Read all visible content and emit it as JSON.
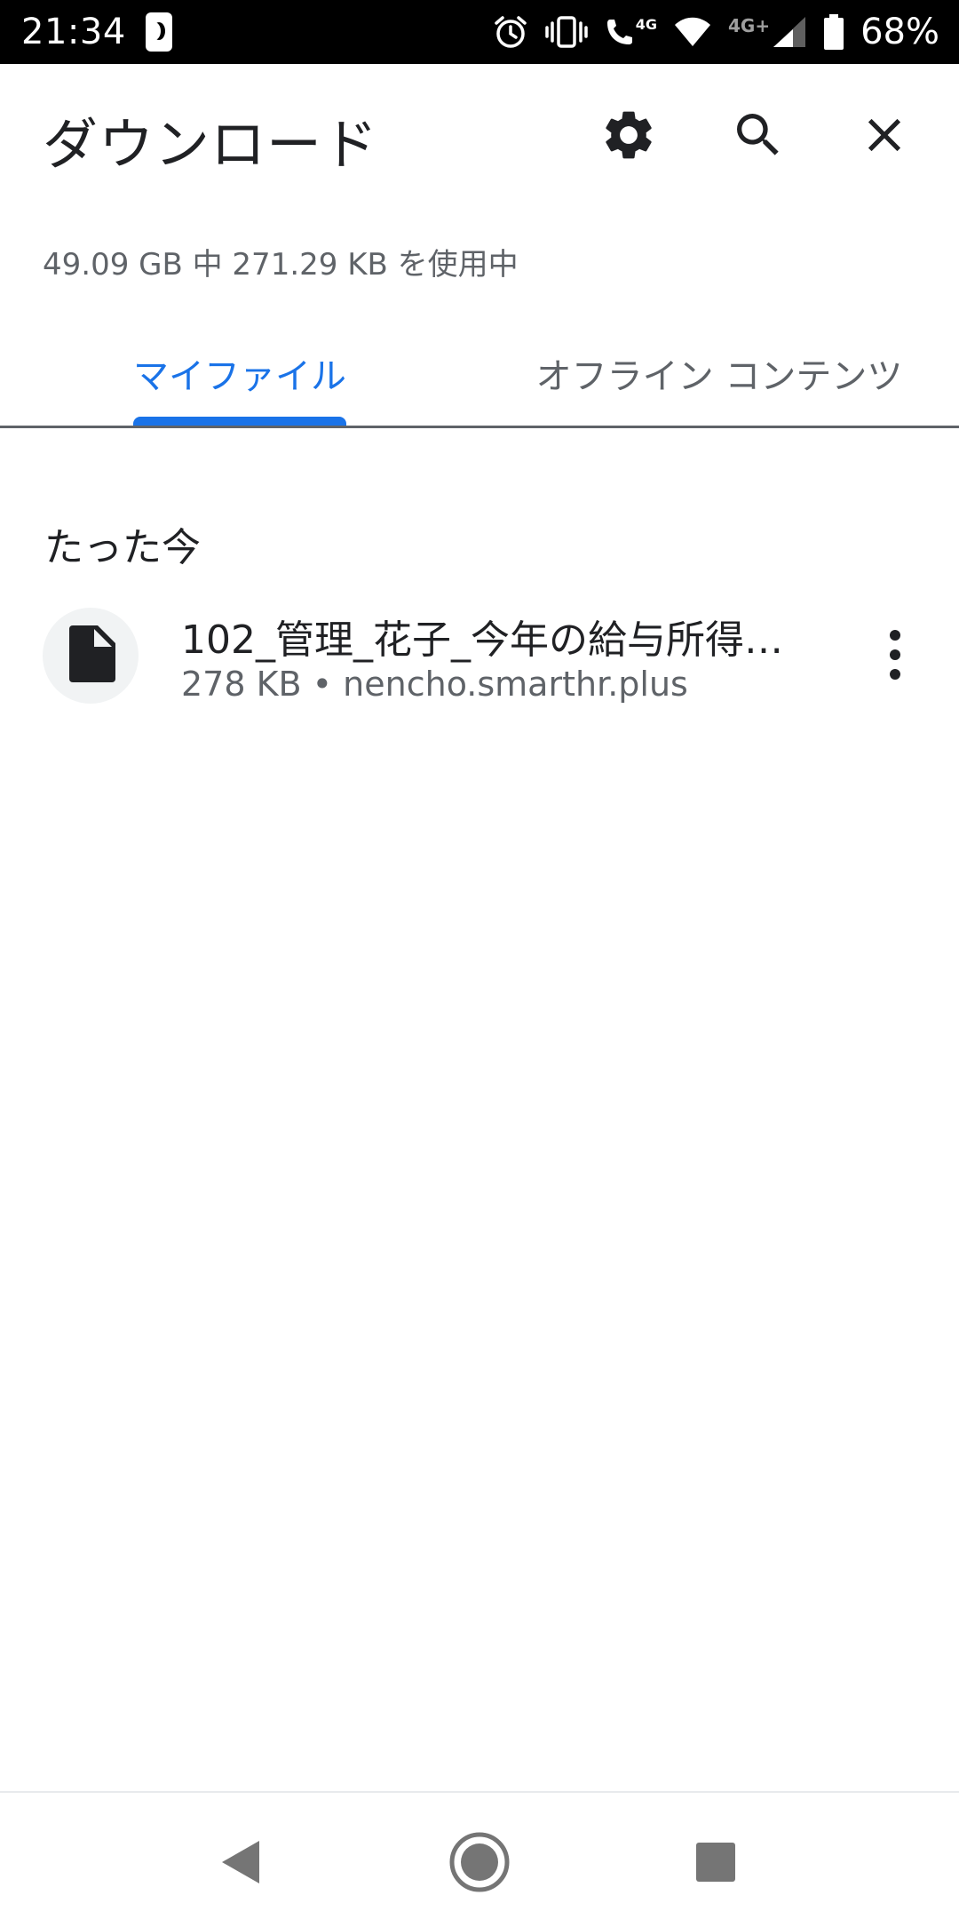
{
  "status_bar": {
    "time": "21:34",
    "network_label": "4G",
    "network_label_secondary": "4G+",
    "battery_percent": "68%",
    "icons": [
      "do-not-disturb-icon",
      "alarm-icon",
      "vibrate-icon",
      "volte-call-icon",
      "wifi-icon",
      "signal-icon",
      "battery-icon"
    ]
  },
  "header": {
    "title": "ダウンロード",
    "icons": [
      "gear-icon",
      "search-icon",
      "close-icon"
    ]
  },
  "storage": {
    "text": "49.09 GB 中 271.29 KB を使用中"
  },
  "tabs": [
    {
      "label": "マイファイル",
      "selected": true
    },
    {
      "label": "オフライン コンテンツ",
      "selected": false
    }
  ],
  "colors": {
    "accent": "#1a73e8",
    "text_primary": "#202124",
    "text_secondary": "#5f6368",
    "icon_bg": "#f1f3f4"
  },
  "sections": [
    {
      "header": "たった今",
      "items": [
        {
          "name": "102_管理_花子_今年の給与所得…",
          "meta": "278 KB • nencho.smarthr.plus",
          "icon": "file-icon"
        }
      ]
    }
  ],
  "nav_bar": {
    "icons": [
      "back-icon",
      "home-icon",
      "recents-icon"
    ]
  }
}
